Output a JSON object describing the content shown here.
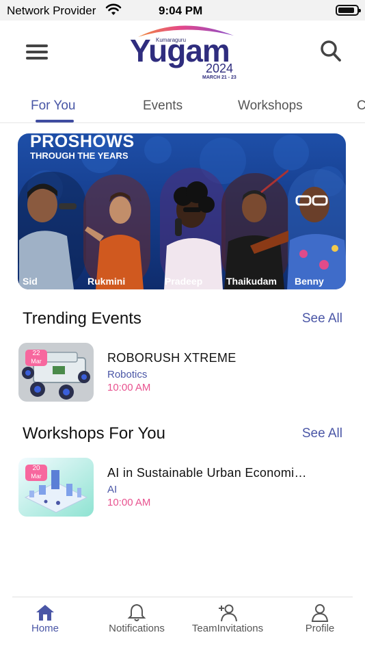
{
  "status_bar": {
    "carrier": "Network Provider",
    "time": "9:04 PM",
    "battery_level": 0.9
  },
  "header": {
    "logo": {
      "org": "Kumaraguru",
      "name": "Yugam",
      "year": "2024",
      "dates": "MARCH 21 - 23"
    },
    "menu_icon": "hamburger-menu-icon",
    "search_icon": "search-icon"
  },
  "tabs": [
    {
      "label": "For You",
      "active": true
    },
    {
      "label": "Events",
      "active": false
    },
    {
      "label": "Workshops",
      "active": false
    },
    {
      "label": "C",
      "active": false
    }
  ],
  "banner": {
    "title": "PROSHOWS",
    "subtitle": "THROUGH THE YEARS",
    "artists": [
      "Sid",
      "Rukmini",
      "Pradeep",
      "Thaikudam",
      "Benny"
    ]
  },
  "trending": {
    "title": "Trending Events",
    "see_all": "See All",
    "items": [
      {
        "date_day": "22",
        "date_month": "Mar",
        "title": "ROBORUSH XTREME",
        "category": "Robotics",
        "time": "10:00 AM"
      }
    ]
  },
  "workshops": {
    "title": "Workshops For You",
    "see_all": "See All",
    "items": [
      {
        "date_day": "20",
        "date_month": "Mar",
        "title": "AI in Sustainable Urban Economi…",
        "category": "AI",
        "time": "10:00 AM"
      }
    ]
  },
  "bottom_nav": [
    {
      "label": "Home",
      "icon": "home-icon",
      "active": true
    },
    {
      "label": "Notifications",
      "icon": "bell-icon",
      "active": false
    },
    {
      "label": "TeamInvitations",
      "icon": "add-person-icon",
      "active": false
    },
    {
      "label": "Profile",
      "icon": "person-icon",
      "active": false
    }
  ],
  "colors": {
    "accent": "#4a56a6",
    "time_pink": "#e8528f",
    "badge_pink": "#f7679e",
    "banner_blue": "#1e4fa8"
  }
}
